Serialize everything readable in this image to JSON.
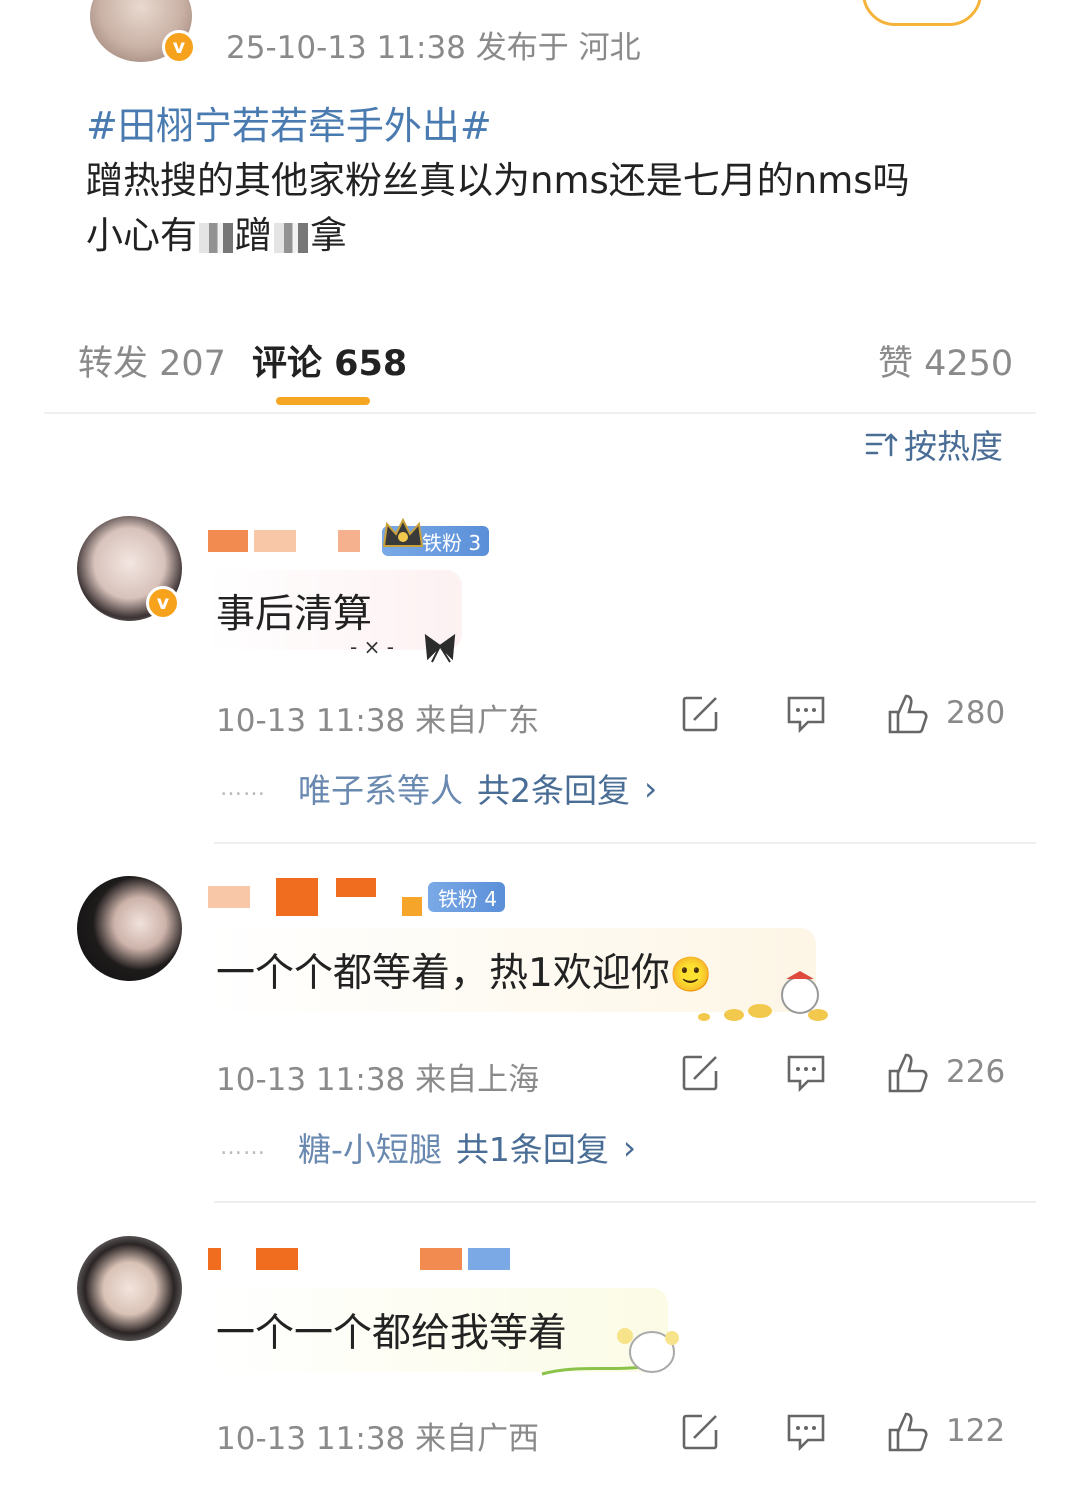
{
  "post": {
    "time_location": "25-10-13 11:38  发布于 河北",
    "verified_mark": "v",
    "topic": "#田栩宁若若牵手外出#",
    "body_line1": "蹭热搜的其他家粉丝真以为nms还是七月的nms吗",
    "body_line2_start": "小心有",
    "body_line2_mid": "蹭",
    "body_line2_end": "拿"
  },
  "tabs": {
    "repost": "转发 207",
    "comment": "评论 658",
    "like": "赞 4250",
    "accent_color": "#f5a623"
  },
  "sort": {
    "label": "按热度",
    "icon": "sort-icon"
  },
  "comments": [
    {
      "fan_badge": "铁粉 3",
      "text": "事后清算",
      "time": "10-13 11:38",
      "location": "来自广东",
      "likes": "280",
      "reply_names": "唯子系等人",
      "reply_summary": "共2条回复",
      "reply_arrow": "›"
    },
    {
      "fan_badge": "铁粉 4",
      "text": "一个个都等着，热1欢迎你",
      "emoji": "🙂",
      "time": "10-13 11:38",
      "location": "来自上海",
      "likes": "226",
      "reply_names": "糖-小短腿",
      "reply_summary": "共1条回复",
      "reply_arrow": "›"
    },
    {
      "text": "一个一个都给我等着",
      "time": "10-13 11:38",
      "location": "来自广西",
      "likes": "122"
    }
  ],
  "colors": {
    "link_blue": "#4a6d96",
    "topic_blue": "#4a7bb0",
    "gray_text": "#8a8a8a",
    "badge_blue": "#5a8fd8"
  }
}
